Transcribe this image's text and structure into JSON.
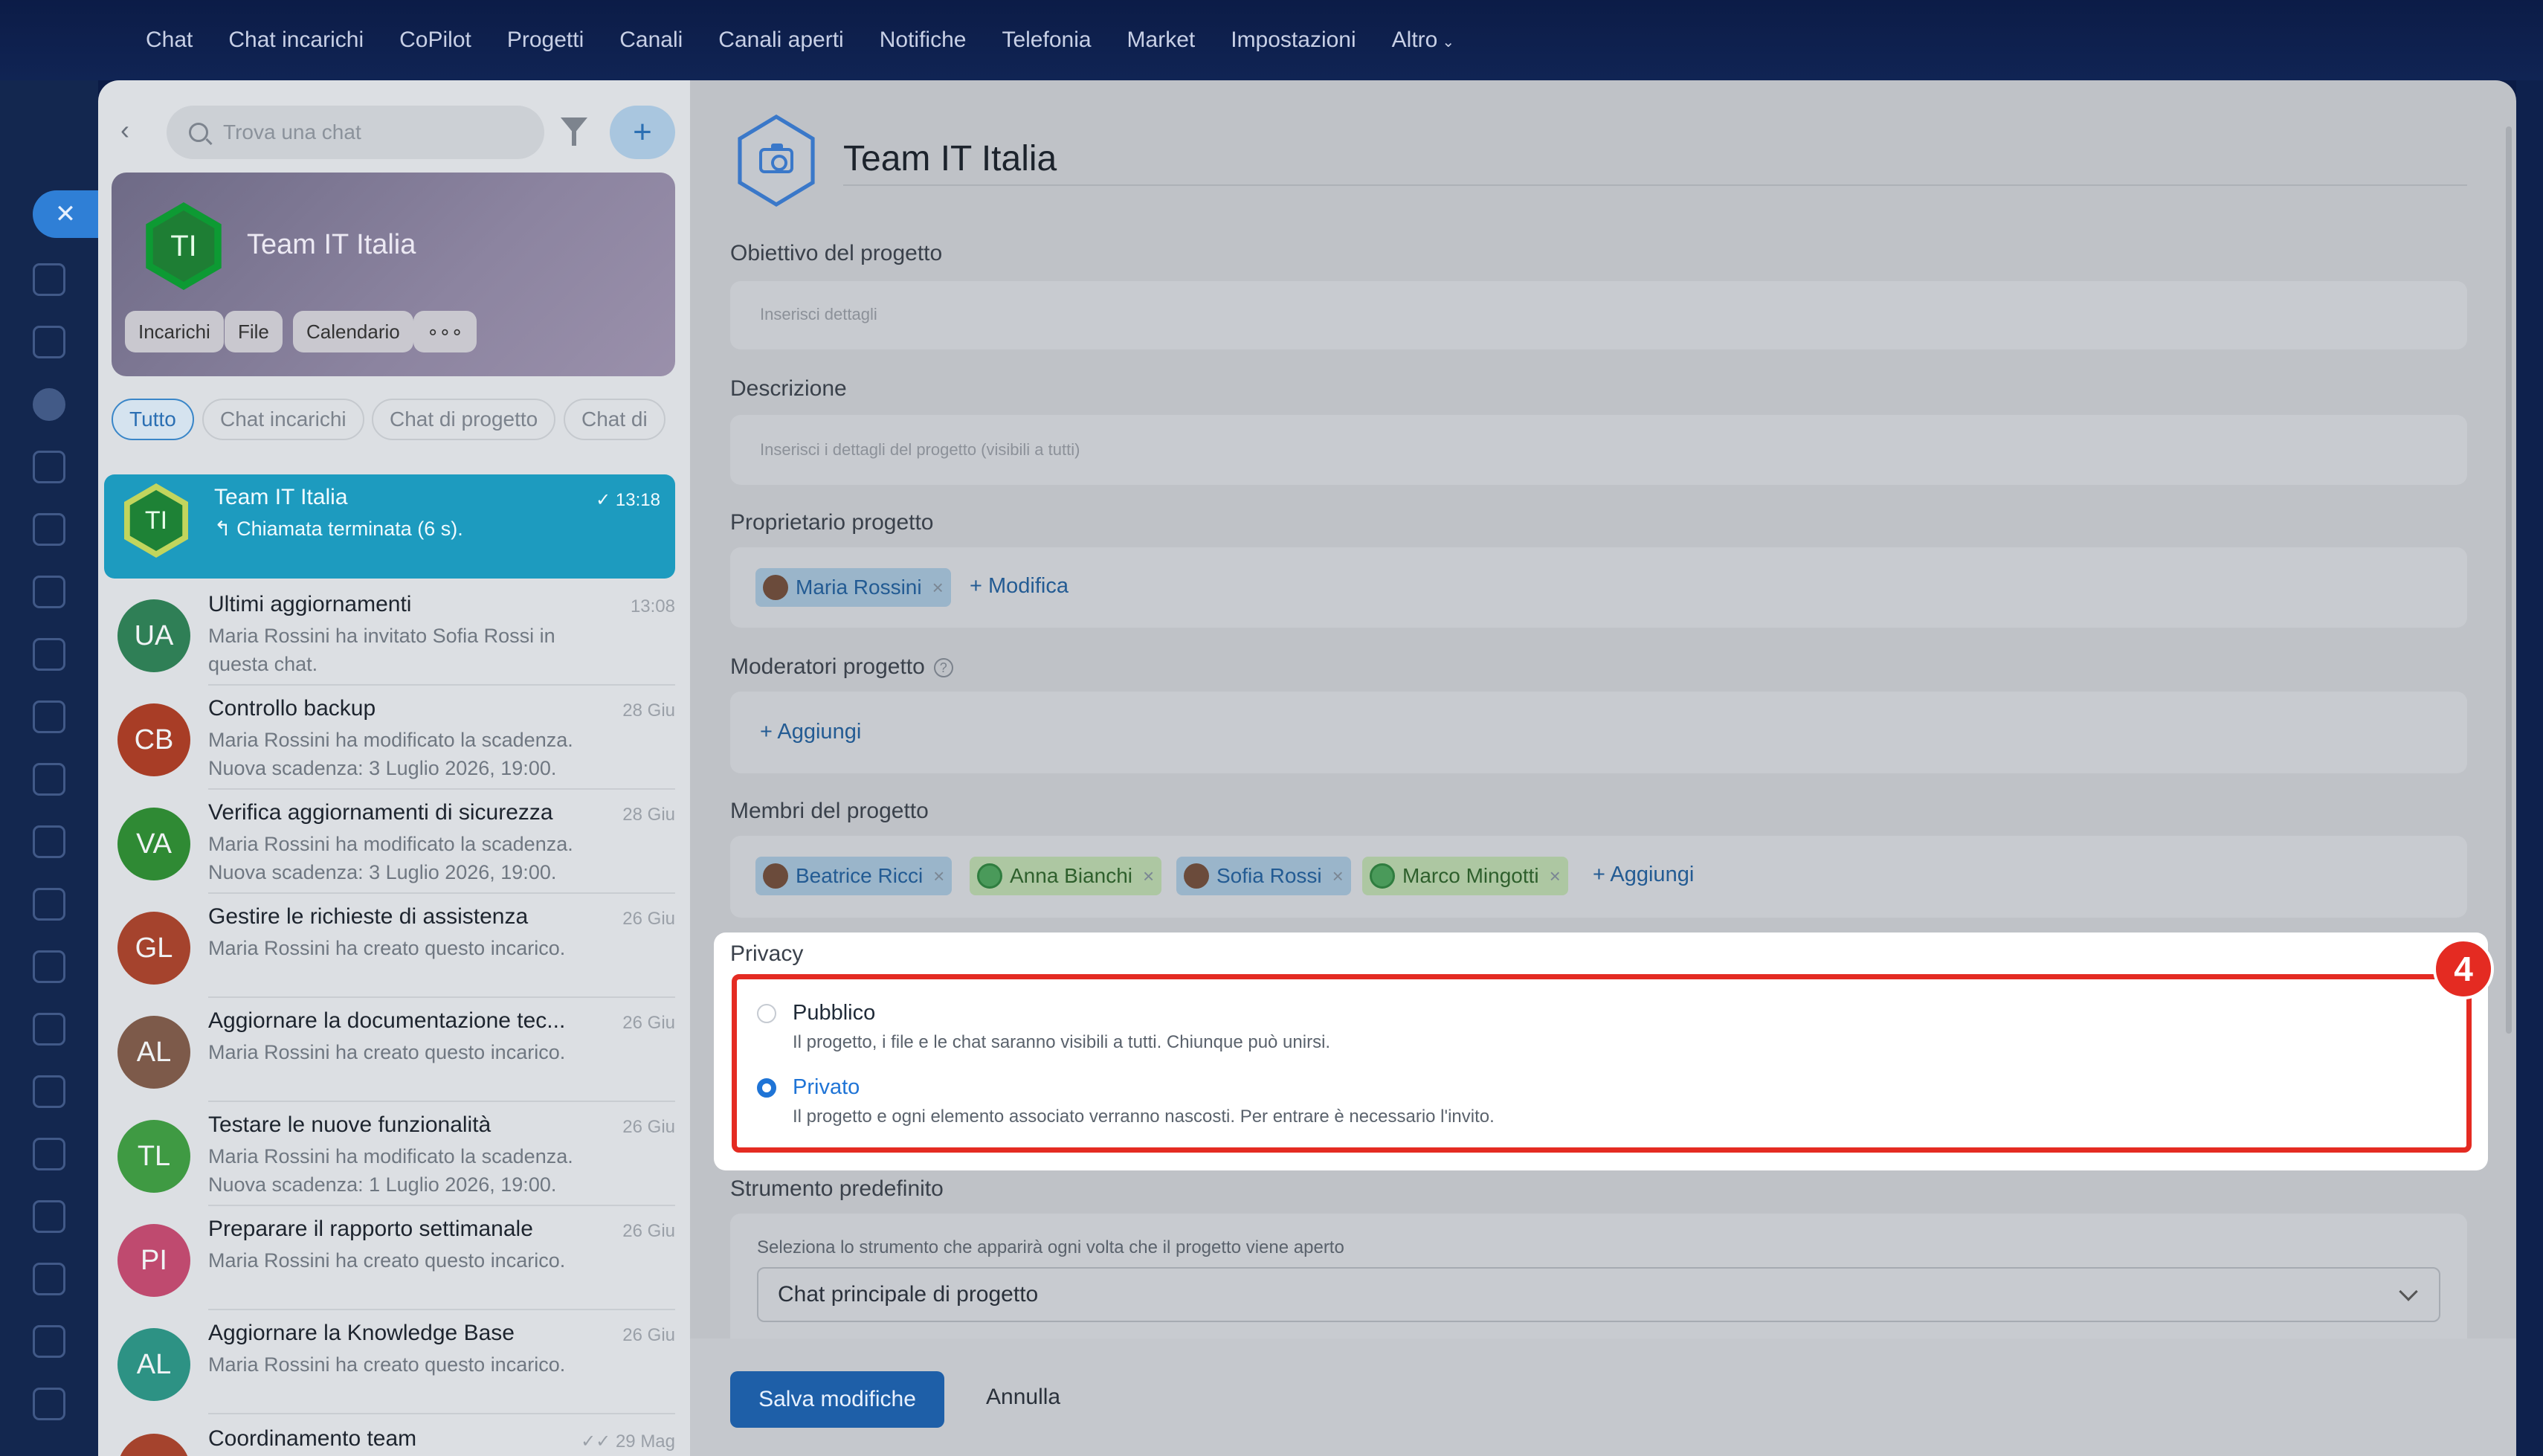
{
  "topnav": {
    "items": [
      "Chat",
      "Chat incarichi",
      "CoPilot",
      "Progetti",
      "Canali",
      "Canali aperti",
      "Notifiche",
      "Telefonia",
      "Market",
      "Impostazioni"
    ],
    "more_label": "Altro"
  },
  "chatlist": {
    "search_placeholder": "Trova una chat",
    "group": {
      "initials": "TI",
      "title": "Team IT Italia",
      "chips": [
        "Incarichi",
        "File",
        "Calendario"
      ],
      "more_glyph": "∘∘∘"
    },
    "filters": [
      "Tutto",
      "Chat incarichi",
      "Chat di progetto",
      "Chat di"
    ],
    "items": [
      {
        "initials": "TI",
        "title": "Team IT Italia",
        "message": "↰ Chiamata terminata (6 s).",
        "time": "✓ 13:18",
        "color": "#1e8236",
        "selected": true
      },
      {
        "initials": "UA",
        "title": "Ultimi aggiornamenti",
        "message": "Maria Rossini ha invitato Sofia Rossi in questa chat.",
        "time": "13:08",
        "color": "#2f7f56"
      },
      {
        "initials": "CB",
        "title": "Controllo backup",
        "message": "Maria Rossini ha modificato la scadenza. Nuova scadenza: 3 Luglio 2026, 19:00.",
        "time": "28 Giu",
        "color": "#a83d26"
      },
      {
        "initials": "VA",
        "title": "Verifica aggiornamenti di sicurezza",
        "message": "Maria Rossini ha modificato la scadenza. Nuova scadenza: 3 Luglio 2026, 19:00.",
        "time": "28 Giu",
        "color": "#2f8a34"
      },
      {
        "initials": "GL",
        "title": "Gestire le richieste di assistenza",
        "message": "Maria Rossini ha creato questo incarico.",
        "time": "26 Giu",
        "color": "#a5432d"
      },
      {
        "initials": "AL",
        "title": "Aggiornare la documentazione tec...",
        "message": "Maria Rossini ha creato questo incarico.",
        "time": "26 Giu",
        "color": "#7d5a4a"
      },
      {
        "initials": "TL",
        "title": "Testare le nuove funzionalità",
        "message": "Maria Rossini ha modificato la scadenza. Nuova scadenza: 1 Luglio 2026, 19:00.",
        "time": "26 Giu",
        "color": "#3f9a43"
      },
      {
        "initials": "PI",
        "title": "Preparare il rapporto settimanale",
        "message": "Maria Rossini ha creato questo incarico.",
        "time": "26 Giu",
        "color": "#bf4a6f"
      },
      {
        "initials": "AL",
        "title": "Aggiornare la Knowledge Base",
        "message": "Maria Rossini ha creato questo incarico.",
        "time": "26 Giu",
        "color": "#2d9284"
      },
      {
        "initials": "",
        "title": "Coordinamento team",
        "message": "",
        "time": "✓✓ 29 Mag",
        "color": "#a5432d"
      }
    ]
  },
  "form": {
    "project_title": "Team IT Italia",
    "objective": {
      "label": "Obiettivo del progetto",
      "placeholder": "Inserisci dettagli"
    },
    "description": {
      "label": "Descrizione",
      "placeholder": "Inserisci i dettagli del progetto (visibili a tutti)"
    },
    "owner": {
      "label": "Proprietario progetto",
      "user": "Maria Rossini",
      "edit_label": "+ Modifica"
    },
    "moderators": {
      "label": "Moderatori progetto",
      "help_glyph": "?",
      "add_label": "+ Aggiungi"
    },
    "members": {
      "label": "Membri del progetto",
      "users": [
        "Beatrice Ricci",
        "Anna Bianchi",
        "Sofia Rossi",
        "Marco Mingotti"
      ],
      "add_label": "+ Aggiungi"
    },
    "privacy": {
      "label": "Privacy",
      "step_number": "4",
      "options": [
        {
          "label": "Pubblico",
          "description": "Il progetto, i file e le chat saranno visibili a tutti. Chiunque può unirsi.",
          "checked": false
        },
        {
          "label": "Privato",
          "description": "Il progetto e ogni elemento associato verranno nascosti. Per entrare è necessario l'invito.",
          "checked": true
        }
      ]
    },
    "default_tool": {
      "label": "Strumento predefinito",
      "hint": "Seleziona lo strumento che apparirà ogni volta che il progetto viene aperto",
      "selected": "Chat principale di progetto"
    },
    "save_label": "Salva modifiche",
    "cancel_label": "Annulla"
  },
  "colors": {
    "accent": "#1f74d6",
    "highlight": "#e42b22",
    "nav_bg": "#0c1c47"
  }
}
